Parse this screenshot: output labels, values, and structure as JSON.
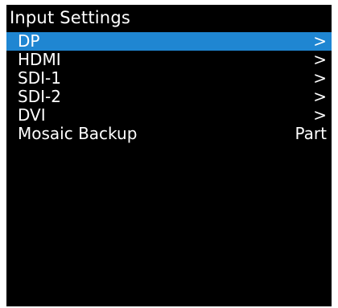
{
  "screen": {
    "title": "Input Settings",
    "background": "#000000",
    "highlight_color": "#1f86d2"
  },
  "menu": {
    "items": [
      {
        "label": "DP",
        "value": ">",
        "selected": true
      },
      {
        "label": "HDMI",
        "value": ">"
      },
      {
        "label": "SDI-1",
        "value": ">"
      },
      {
        "label": "SDI-2",
        "value": ">"
      },
      {
        "label": "DVI",
        "value": ">"
      },
      {
        "label": "Mosaic Backup",
        "value": "Part"
      }
    ]
  }
}
